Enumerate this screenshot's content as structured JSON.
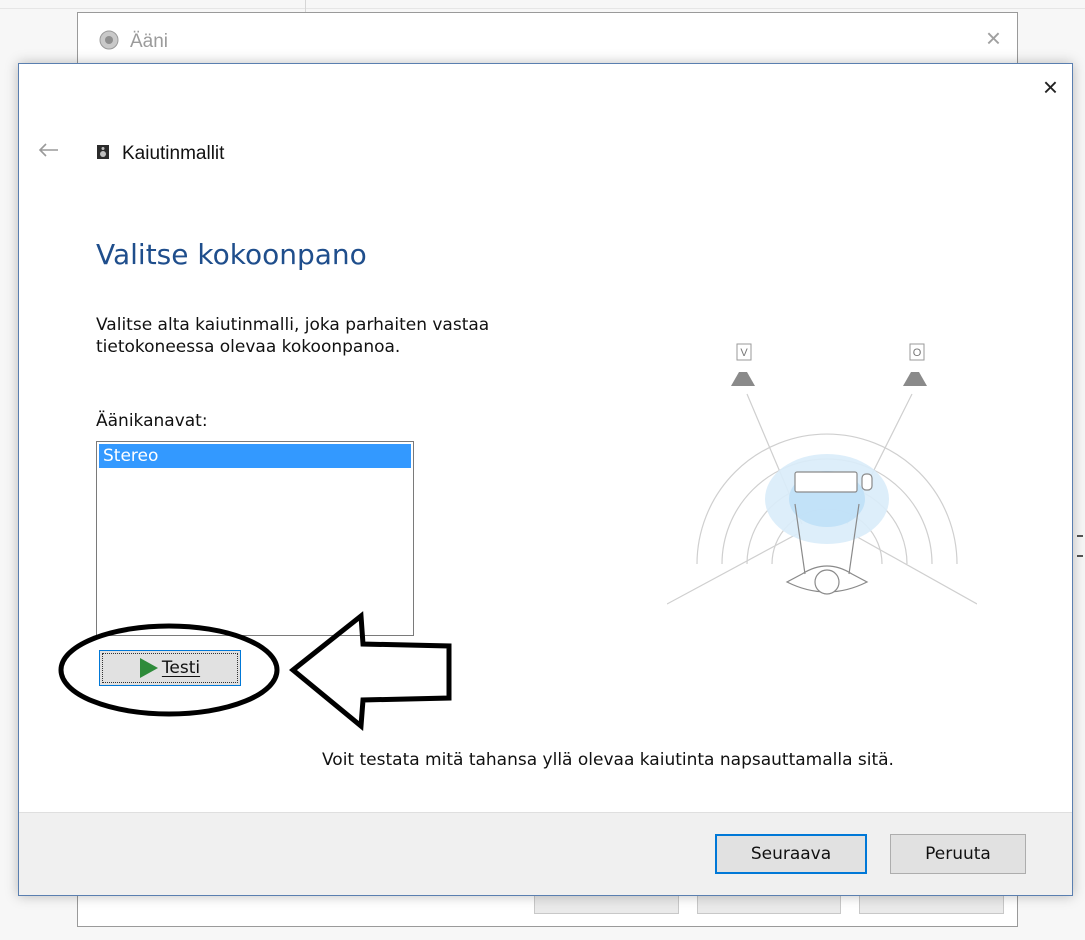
{
  "parent_window": {
    "title": "Ääni",
    "close_glyph": "×"
  },
  "wizard": {
    "close_glyph": "×",
    "header_title": "Kaiutinmallit",
    "heading": "Valitse kokoonpano",
    "instruction": "Valitse alta kaiutinmalli, joka parhaiten vastaa tietokoneessa olevaa kokoonpanoa.",
    "channels_label": "Äänikanavat:",
    "channels": [
      {
        "label": "Stereo",
        "selected": true
      }
    ],
    "test_button_label": "Testi",
    "hint": "Voit testata mitä tahansa yllä olevaa kaiutinta napsauttamalla sitä.",
    "speaker_labels": {
      "left": "V",
      "right": "O"
    },
    "footer": {
      "next_label": "Seuraava",
      "cancel_label": "Peruuta"
    }
  },
  "colors": {
    "heading": "#1f4e8c",
    "selection": "#3399ff",
    "accent_border": "#0078d7",
    "play_icon": "#2e8b3a"
  },
  "icons": [
    "speaker-icon",
    "back-arrow-icon",
    "close-icon",
    "play-icon",
    "speaker-setup-diagram"
  ]
}
